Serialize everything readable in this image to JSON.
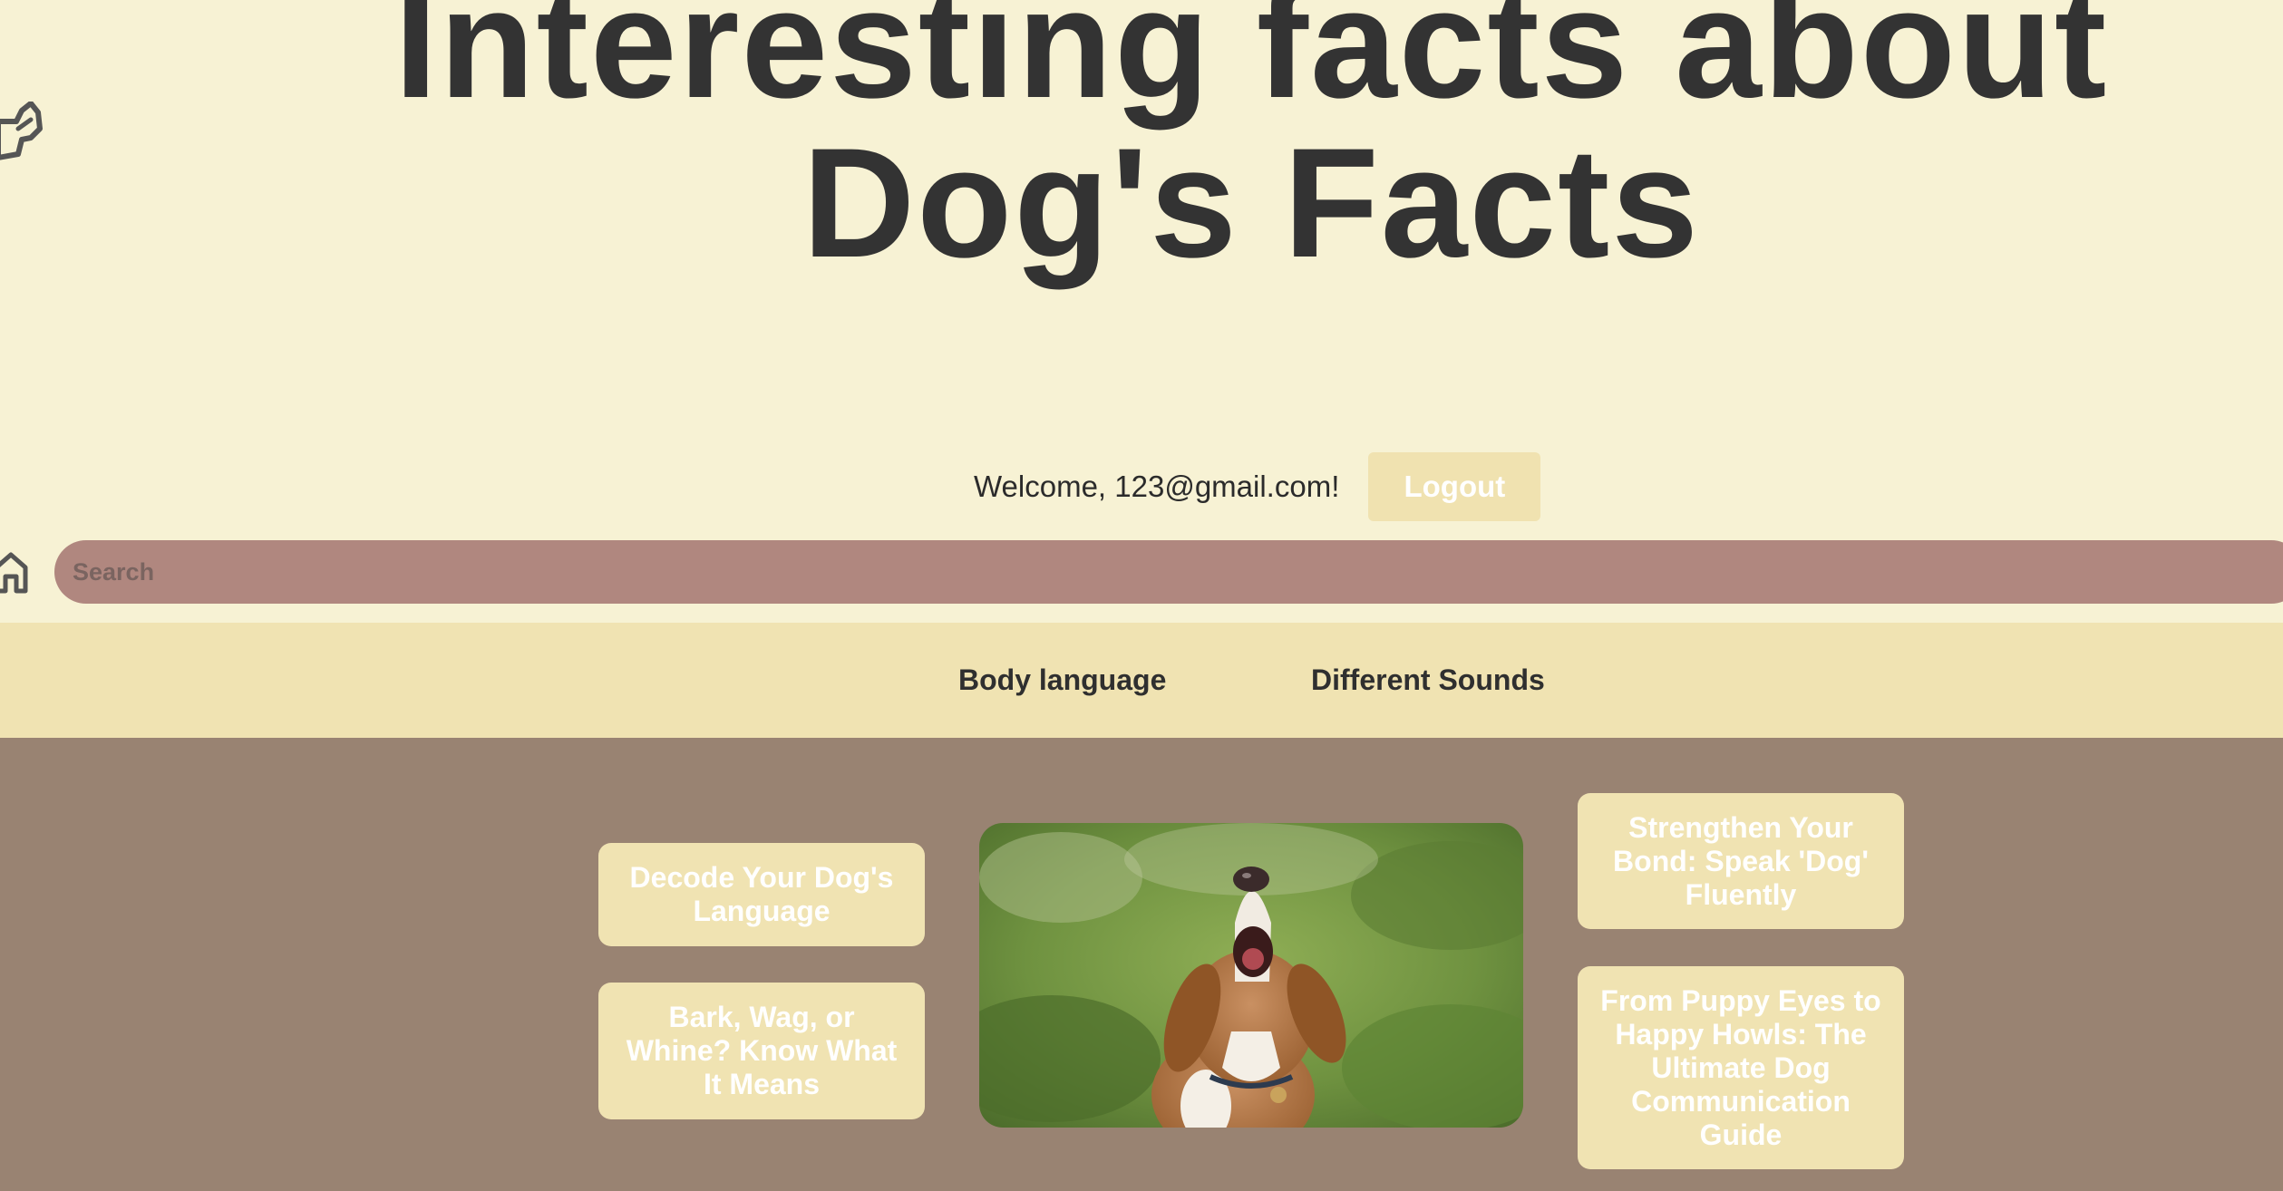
{
  "header": {
    "title": "Interesting facts about Dog's Facts",
    "logo_icon": "dog-head-icon"
  },
  "user": {
    "welcome_text": "Welcome, 123@gmail.com!",
    "logout_label": "Logout"
  },
  "search": {
    "placeholder": "Search",
    "home_icon": "home-icon"
  },
  "nav": {
    "items": [
      {
        "label": "Body language"
      },
      {
        "label": "Different Sounds"
      }
    ]
  },
  "main": {
    "cards": [
      {
        "label": "Decode Your Dog's Language"
      },
      {
        "label": "Bark, Wag, or Whine? Know What It Means"
      },
      {
        "label": "Strengthen Your Bond: Speak 'Dog' Fluently"
      },
      {
        "label": "From Puppy Eyes to Happy Howls: The Ultimate Dog Communication Guide"
      }
    ],
    "image_subject": "beagle-howling-photo"
  },
  "colors": {
    "page_background": "#f7f2d4",
    "search_bar": "#b0877f",
    "nav_bar": "#f0e3b2",
    "content_background": "#998372",
    "card_background": "#f0e3b2",
    "text_dark": "#333333"
  }
}
